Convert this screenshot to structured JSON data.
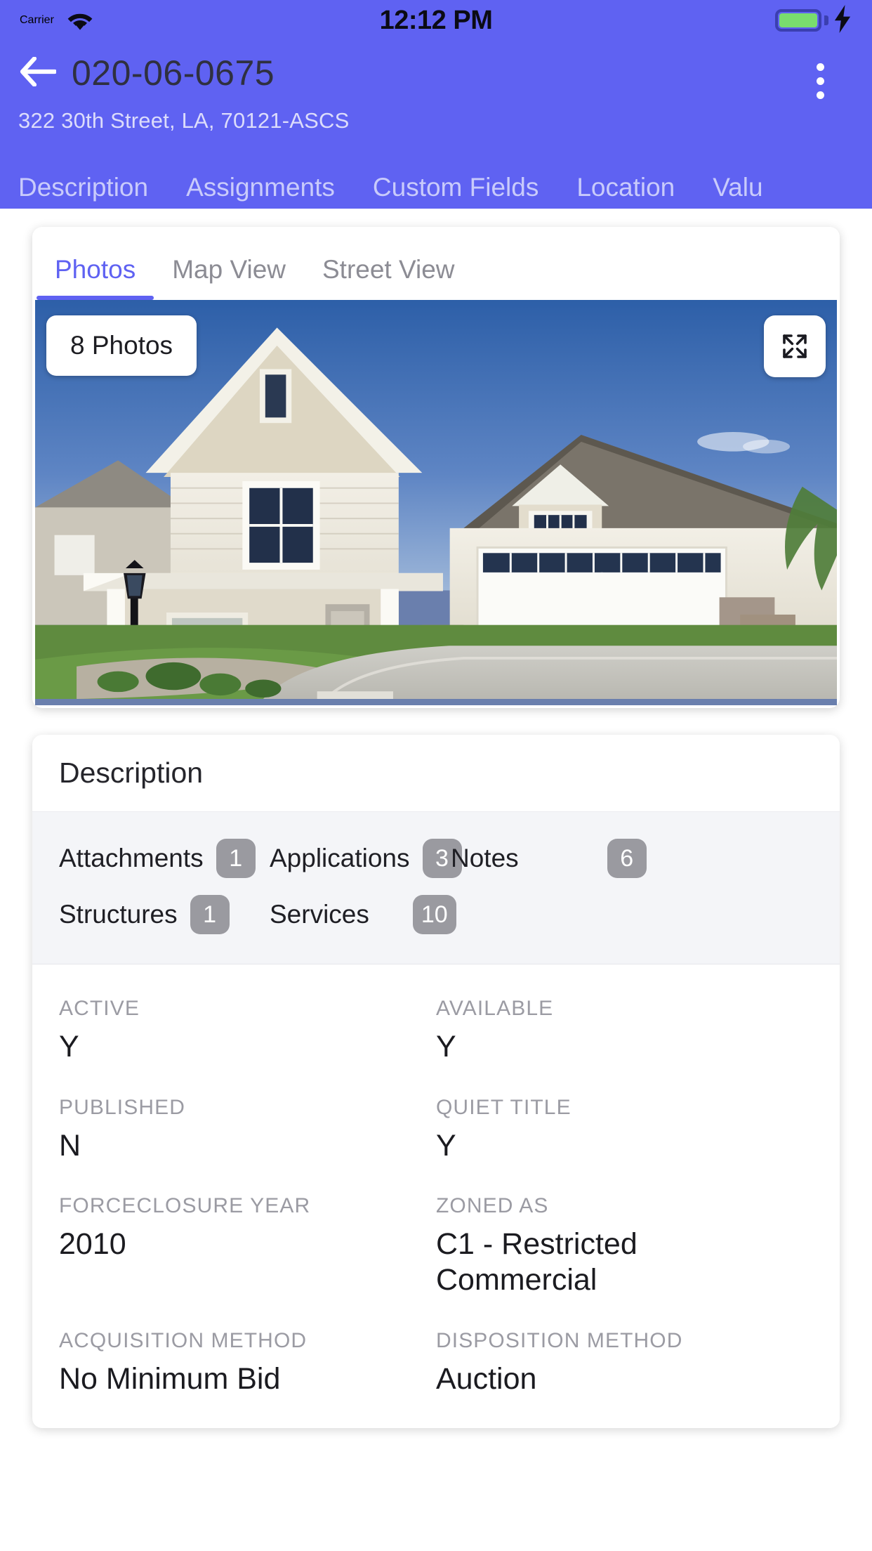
{
  "status_bar": {
    "carrier": "Carrier",
    "time": "12:12 PM",
    "wifi_icon": "wifi-icon",
    "battery_icon": "battery-full-icon",
    "charging_icon": "lightning-bolt-icon",
    "battery_color": "#79dd6e"
  },
  "header": {
    "back_icon": "arrow-left-icon",
    "title": "020-06-0675",
    "address": "322 30th Street, LA, 70121-ASCS",
    "overflow_icon": "more-vertical-icon",
    "background_color": "#5f62f2",
    "tabs": [
      {
        "label": "Description"
      },
      {
        "label": "Assignments"
      },
      {
        "label": "Custom Fields"
      },
      {
        "label": "Location"
      },
      {
        "label": "Valu"
      }
    ]
  },
  "media_card": {
    "tabs": [
      {
        "label": "Photos",
        "active": true
      },
      {
        "label": "Map View",
        "active": false
      },
      {
        "label": "Street View",
        "active": false
      }
    ],
    "photos_badge": "8 Photos",
    "expand_icon": "fullscreen-expand-icon"
  },
  "description_card": {
    "title": "Description",
    "chips": [
      {
        "label": "Attachments",
        "count": "1"
      },
      {
        "label": "Applications",
        "count": "3"
      },
      {
        "label": "Notes",
        "count": "6"
      },
      {
        "label": "Structures",
        "count": "1"
      },
      {
        "label": "Services",
        "count": "10"
      }
    ],
    "fields": [
      {
        "label": "ACTIVE",
        "value": "Y"
      },
      {
        "label": "AVAILABLE",
        "value": "Y"
      },
      {
        "label": "PUBLISHED",
        "value": "N"
      },
      {
        "label": "QUIET TITLE",
        "value": "Y"
      },
      {
        "label": "FORCECLOSURE YEAR",
        "value": "2010"
      },
      {
        "label": "ZONED AS",
        "value": "C1 - Restricted Commercial"
      },
      {
        "label": "ACQUISITION METHOD",
        "value": "No Minimum Bid"
      },
      {
        "label": "DISPOSITION METHOD",
        "value": "Auction"
      }
    ]
  }
}
